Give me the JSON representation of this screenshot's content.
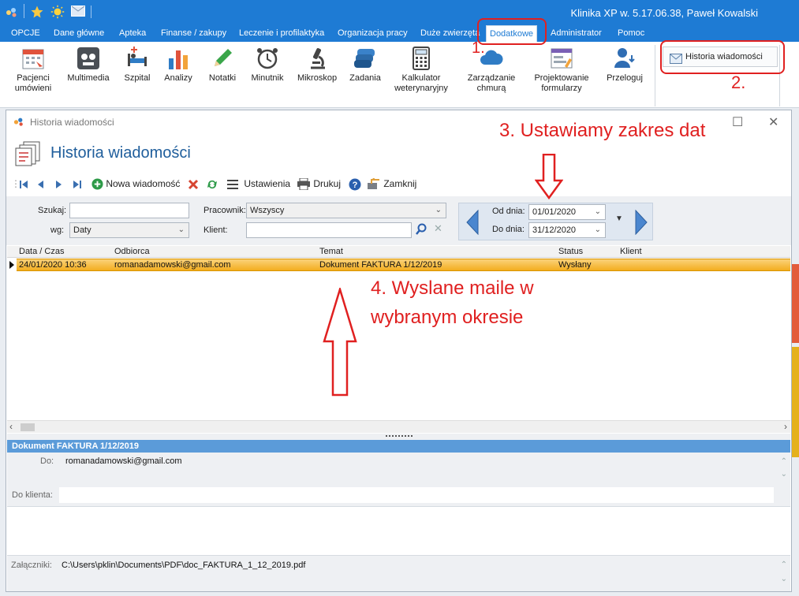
{
  "titlebar": {
    "title": "Klinika XP w. 5.17.06.38, Paweł Kowalski"
  },
  "ribbon_tabs": [
    "OPCJE",
    "Dane główne",
    "Apteka",
    "Finanse / zakupy",
    "Leczenie i profilaktyka",
    "Organizacja pracy",
    "Duże zwierzęta",
    "Dodatkowe",
    "Administrator",
    "Pomoc"
  ],
  "ribbon_buttons": [
    {
      "label": "Pacjenci\numówieni",
      "icon": "calendar-icon"
    },
    {
      "label": "Multimedia",
      "icon": "multimedia-icon"
    },
    {
      "label": "Szpital",
      "icon": "hospital-bed-icon"
    },
    {
      "label": "Analizy",
      "icon": "bar-chart-icon"
    },
    {
      "label": "Notatki",
      "icon": "pencil-icon"
    },
    {
      "label": "Minutnik",
      "icon": "alarm-clock-icon"
    },
    {
      "label": "Mikroskop",
      "icon": "microscope-icon"
    },
    {
      "label": "Zadania",
      "icon": "tasks-icon"
    },
    {
      "label": "Kalkulator\nweterynaryjny",
      "icon": "calculator-icon"
    },
    {
      "label": "Zarządzanie\nchmurą",
      "icon": "cloud-icon"
    },
    {
      "label": "Projektowanie\nformularzy",
      "icon": "form-design-icon"
    },
    {
      "label": "Przeloguj",
      "icon": "relogin-icon"
    }
  ],
  "ribbon_side": {
    "history_label": "Historia wiadomości"
  },
  "window": {
    "title": "Historia wiadomości",
    "heading": "Historia wiadomości"
  },
  "toolbar": {
    "new_message": "Nowa wiadomość",
    "settings": "Ustawienia",
    "print": "Drukuj",
    "close": "Zamknij"
  },
  "filters": {
    "search_label": "Szukaj:",
    "search_value": "",
    "by_label": "wg:",
    "by_value": "Daty",
    "employee_label": "Pracownik:",
    "employee_value": "Wszyscy",
    "client_label": "Klient:",
    "client_value": "",
    "from_label": "Od dnia:",
    "from_value": "01/01/2020",
    "to_label": "Do dnia:",
    "to_value": "31/12/2020"
  },
  "grid": {
    "columns": [
      "Data / Czas",
      "Odbiorca",
      "Temat",
      "Status",
      "Klient"
    ],
    "rows": [
      {
        "datetime": "24/01/2020 10:36",
        "recipient": "romanadamowski@gmail.com",
        "subject": "Dokument FAKTURA 1/12/2019",
        "status": "Wysłany",
        "client": ""
      }
    ]
  },
  "detail": {
    "header": "Dokument FAKTURA 1/12/2019",
    "to_label": "Do:",
    "to_value": "romanadamowski@gmail.com",
    "client_label": "Do klienta:",
    "client_value": "",
    "attach_label": "Załączniki:",
    "attach_value": "C:\\Users\\pklin\\Documents\\PDF\\doc_FAKTURA_1_12_2019.pdf"
  },
  "annotations": {
    "n1": "1.",
    "n2": "2.",
    "n3": "3. Ustawiamy zakres dat",
    "n4_line1": "4. Wyslane maile w",
    "n4_line2": "wybranym okresie"
  },
  "colors": {
    "accent": "#1e7bd4",
    "annotation": "#e02020",
    "selection": "#f3ad1f",
    "detail_header": "#5b9bd9"
  }
}
